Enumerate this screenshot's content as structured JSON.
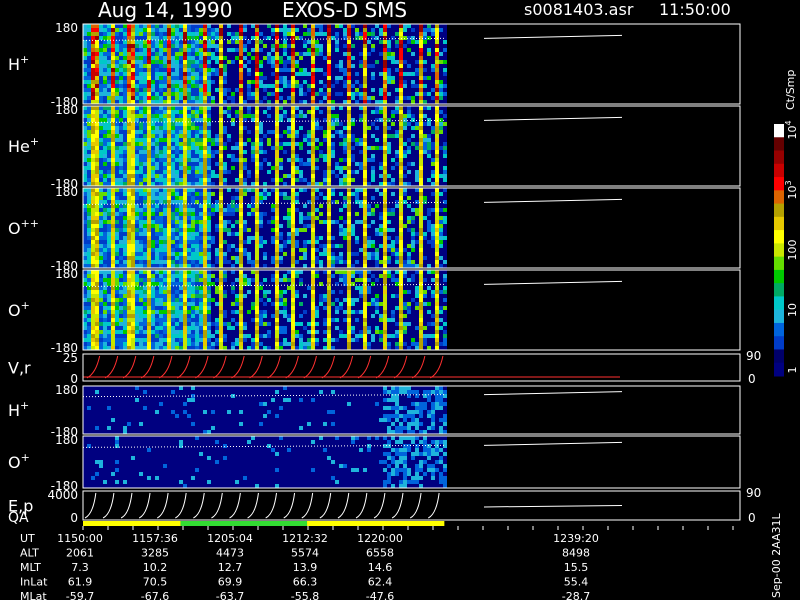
{
  "header": {
    "date": "Aug 14, 1990",
    "instrument": "EXOS-D SMS",
    "file": "s0081403.asr",
    "time": "11:50:00"
  },
  "colorbar": {
    "label": "Ct/Smp",
    "ticks": [
      {
        "label": "1",
        "value": 1
      },
      {
        "label": "10",
        "value": 10
      },
      {
        "label": "100",
        "value": 100
      },
      {
        "label": "10",
        "sup": "3",
        "value": 1000
      },
      {
        "label": "10",
        "sup": "4",
        "value": 10000
      }
    ],
    "colors": [
      "#000080",
      "#00006a",
      "#003cc8",
      "#0064dc",
      "#1eb4dc",
      "#00c8c8",
      "#00aa64",
      "#00c800",
      "#64dc00",
      "#c8e600",
      "#ffff00",
      "#e6c800",
      "#b4a000",
      "#dc6400",
      "#ff0000",
      "#c80000",
      "#960000",
      "#640000",
      "#ffffff"
    ]
  },
  "side_note": "Sep-00 2AA31L",
  "chart_data": {
    "type": "heatmap",
    "panels": [
      {
        "label": "H",
        "sup": "+",
        "ytop": "180",
        "ybot": "-180",
        "kind": "pitch"
      },
      {
        "label": "He",
        "sup": "+",
        "ytop": "180",
        "ybot": "-180",
        "kind": "pitch"
      },
      {
        "label": "O",
        "sup": "++",
        "ytop": "180",
        "ybot": "-180",
        "kind": "pitch"
      },
      {
        "label": "O",
        "sup": "+",
        "ytop": "180",
        "ybot": "-180",
        "kind": "pitch"
      },
      {
        "label": "V,r",
        "ytop": "25",
        "ybot": "0",
        "right_top": "90",
        "right_bot": "0",
        "kind": "line"
      },
      {
        "label": "H",
        "sup": "+",
        "ytop": "180",
        "ybot": "-180",
        "kind": "pitch2"
      },
      {
        "label": "O",
        "sup": "+",
        "ytop": "180",
        "ybot": "-180",
        "kind": "pitch2"
      },
      {
        "label": "E,p",
        "ytop": "4000",
        "ybot": "0",
        "right_top": "90",
        "right_bot": "0",
        "kind": "energy"
      }
    ],
    "qa_label": "QA",
    "qa_segments": [
      {
        "from": 0,
        "to": 0.27,
        "color": "#ffff00"
      },
      {
        "from": 0.27,
        "to": 0.62,
        "color": "#33dd33"
      },
      {
        "from": 0.62,
        "to": 1.0,
        "color": "#ffff00"
      }
    ],
    "data_extent_fraction": 0.55,
    "time_axis": {
      "row_labels": [
        "UT",
        "ALT",
        "MLT",
        "InLat",
        "MLat"
      ],
      "columns": [
        {
          "UT": "1150:00",
          "ALT": "2061",
          "MLT": "7.3",
          "InLat": "61.9",
          "MLat": "-59.7"
        },
        {
          "UT": "1157:36",
          "ALT": "3285",
          "MLT": "10.2",
          "InLat": "70.5",
          "MLat": "-67.6"
        },
        {
          "UT": "1205:04",
          "ALT": "4473",
          "MLT": "12.7",
          "InLat": "69.9",
          "MLat": "-63.7"
        },
        {
          "UT": "1212:32",
          "ALT": "5574",
          "MLT": "13.9",
          "InLat": "66.3",
          "MLat": "-55.8"
        },
        {
          "UT": "1220:00",
          "ALT": "6558",
          "MLT": "14.6",
          "InLat": "62.4",
          "MLat": "-47.6"
        },
        {
          "UT": "1239:20",
          "ALT": "8498",
          "MLT": "15.5",
          "InLat": "55.4",
          "MLat": "-28.7"
        }
      ]
    }
  }
}
